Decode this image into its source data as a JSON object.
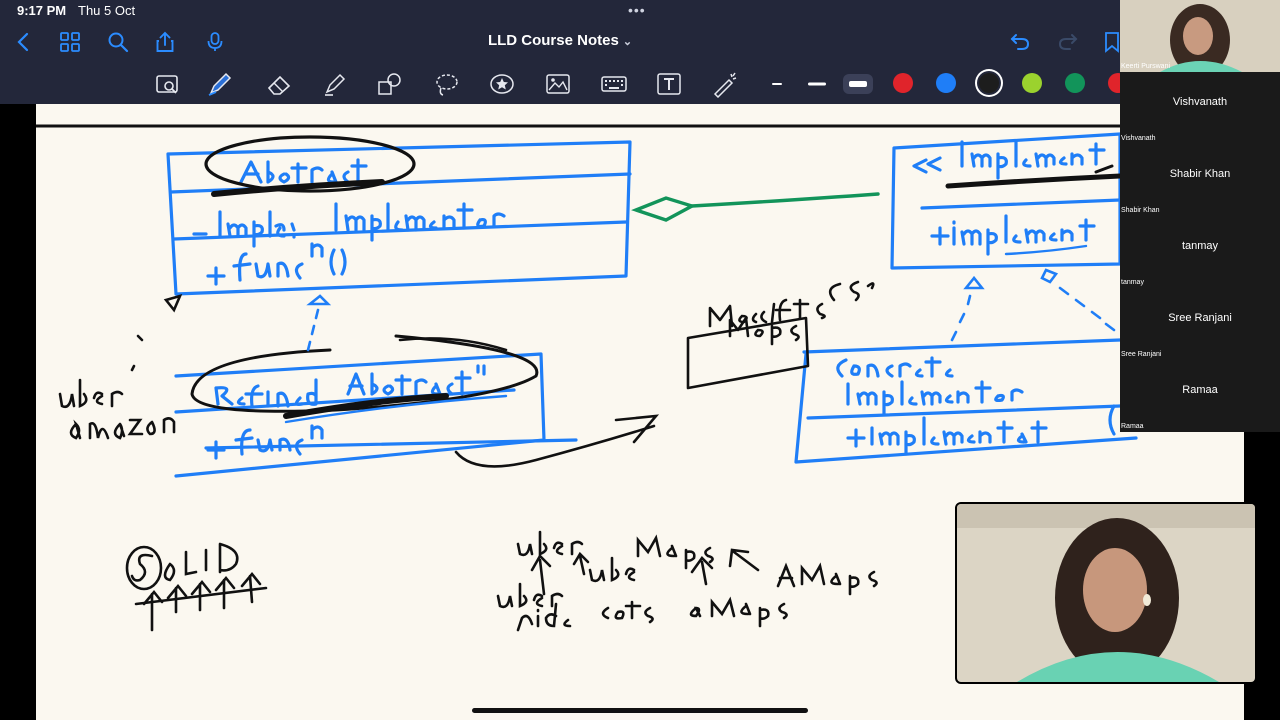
{
  "status": {
    "time": "9:17 PM",
    "date": "Thu 5 Oct",
    "dots": "•••"
  },
  "nav": {
    "title": "LLD Course Notes",
    "chevron": "⌄",
    "icons": [
      "back-icon",
      "grid-icon",
      "search-icon",
      "share-icon",
      "mic-icon",
      "undo-icon",
      "redo-icon",
      "bookmark-icon"
    ]
  },
  "toolbar": {
    "tools": [
      "lasso-zoom-icon",
      "pen-icon",
      "eraser-icon",
      "highlighter-icon",
      "shapes-icon",
      "lasso-icon",
      "star-icon",
      "image-icon",
      "keyboard-icon",
      "text-icon",
      "laser-icon"
    ],
    "selected_tool": "pen",
    "colors": [
      "#e0242b",
      "#1f7ef7",
      "#1d1d1d",
      "#9bd22e",
      "#12945a",
      "#e0242b"
    ],
    "selected_color": "#1d1d1d"
  },
  "participants": {
    "self": {
      "name": "Keerti Purswani"
    },
    "others": [
      {
        "name": "Vishvanath"
      },
      {
        "name": "Shabir Khan"
      },
      {
        "name": "tanmay"
      },
      {
        "name": "Sree Ranjani"
      },
      {
        "name": "Ramaa"
      }
    ]
  },
  "colors": {
    "ink_blue": "#1f7ef7",
    "ink_black": "#111111",
    "ink_green": "#12945a",
    "canvas": "#fbf8f0",
    "chrome": "#23273a"
  }
}
